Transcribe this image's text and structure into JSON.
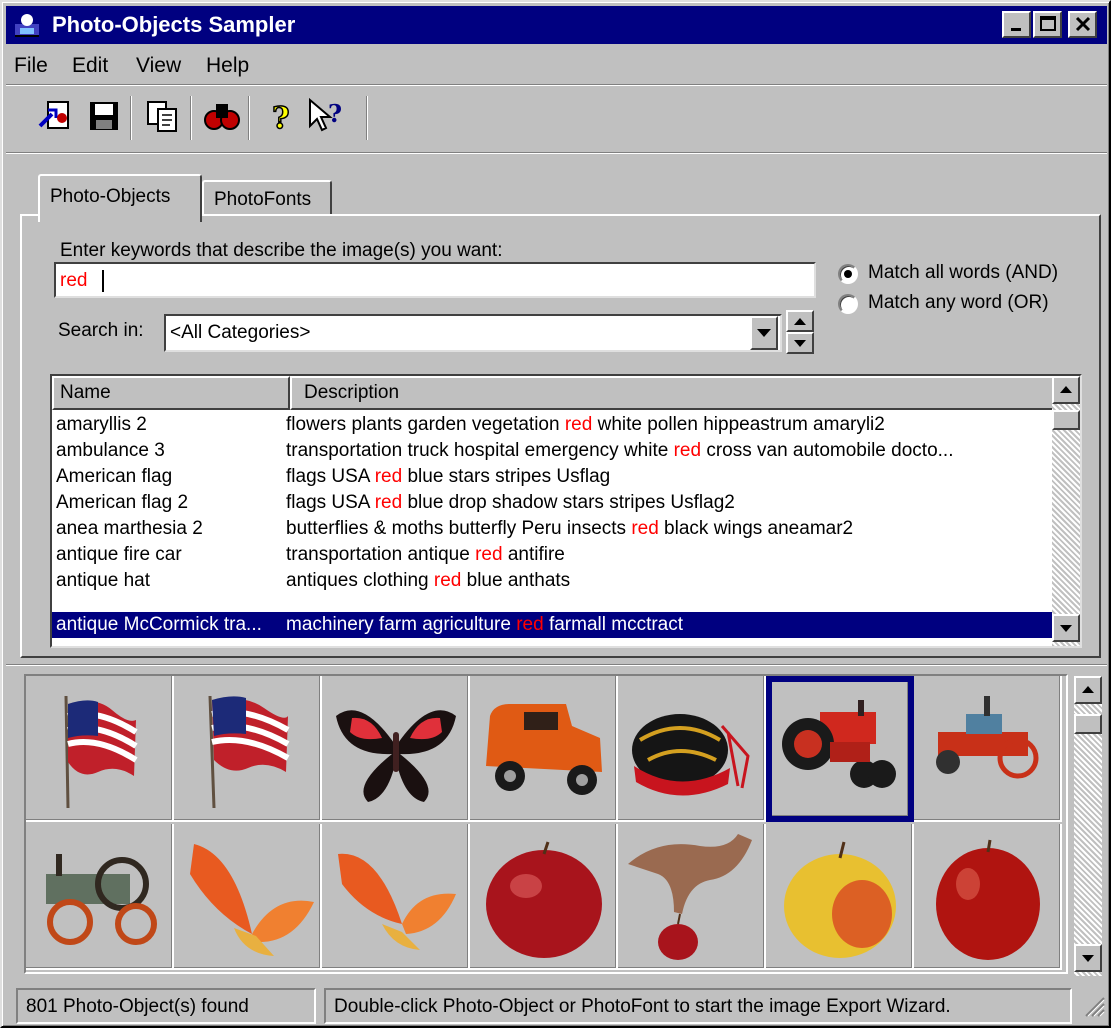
{
  "window": {
    "title": "Photo-Objects Sampler"
  },
  "menu": {
    "file": "File",
    "edit": "Edit",
    "view": "View",
    "help": "Help"
  },
  "toolbar": {
    "buttons": [
      "open-export-icon",
      "save-icon",
      "copy-icon",
      "find-icon",
      "help-icon",
      "context-help-icon"
    ]
  },
  "tabs": [
    {
      "label": "Photo-Objects",
      "active": true
    },
    {
      "label": "PhotoFonts",
      "active": false
    }
  ],
  "search": {
    "prompt": "Enter keywords that describe the image(s) you want:",
    "keywords": "red",
    "match_all_label": "Match all words (AND)",
    "match_any_label": "Match any word (OR)",
    "match_mode": "all",
    "search_in_label": "Search in:",
    "category": "<All Categories>"
  },
  "list": {
    "columns": [
      "Name",
      "Description"
    ],
    "rows": [
      {
        "name": "amaryllis 2",
        "desc_pre": "flowers plants garden vegetation ",
        "keyword": "red",
        "desc_post": " white pollen hippeastrum amaryli2"
      },
      {
        "name": "ambulance 3",
        "desc_pre": "transportation truck hospital emergency white ",
        "keyword": "red",
        "desc_post": " cross van automobile docto..."
      },
      {
        "name": "American flag",
        "desc_pre": "flags USA ",
        "keyword": "red",
        "desc_post": " blue stars stripes Usflag"
      },
      {
        "name": "American flag 2",
        "desc_pre": "flags USA ",
        "keyword": "red",
        "desc_post": " blue drop shadow stars stripes Usflag2"
      },
      {
        "name": "anea marthesia 2",
        "desc_pre": "butterflies & moths butterfly Peru insects ",
        "keyword": "red",
        "desc_post": " black wings aneamar2"
      },
      {
        "name": "antique fire car",
        "desc_pre": "transportation antique ",
        "keyword": "red",
        "desc_post": " antifire"
      },
      {
        "name": "antique hat",
        "desc_pre": "antiques clothing ",
        "keyword": "red",
        "desc_post": " blue anthats"
      },
      {
        "name": "antique McCormick tra...",
        "desc_pre": "machinery farm agriculture ",
        "keyword": "red",
        "desc_post": " farmall mcctract"
      }
    ],
    "selected_row": 7
  },
  "thumbnails": {
    "row1": [
      "american-flag-thumbnail",
      "american-flag-2-thumbnail",
      "butterfly-thumbnail",
      "antique-fire-car-thumbnail",
      "antique-hat-thumbnail",
      "tractor-thumbnail",
      "antique-engine-thumbnail"
    ],
    "row2": [
      "steam-tractor-thumbnail",
      "orange-butterfly-thumbnail",
      "orange-butterfly-2-thumbnail",
      "red-apple-thumbnail",
      "hand-apple-thumbnail",
      "yellow-apple-thumbnail",
      "red-apple-2-thumbnail"
    ],
    "selected_index": 5
  },
  "status": {
    "count": "801 Photo-Object(s) found",
    "hint": "Double-click Photo-Object or PhotoFont to start the image Export Wizard."
  },
  "colors": {
    "titlebar": "#000080",
    "keyword": "#ff0000",
    "selection": "#000080",
    "face": "#c0c0c0"
  }
}
